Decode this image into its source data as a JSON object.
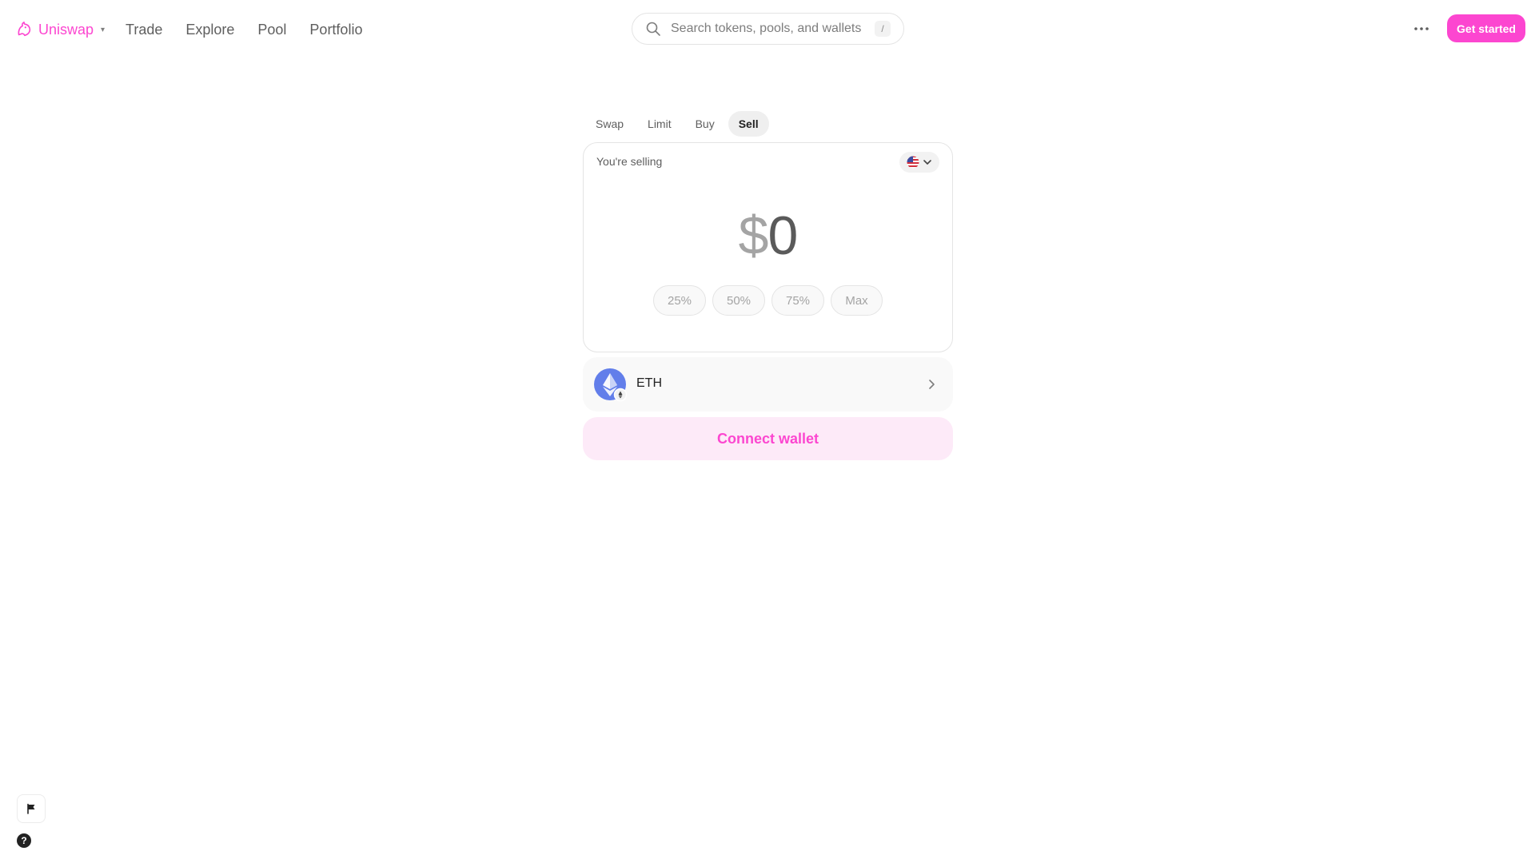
{
  "nav": {
    "logo_text": "Uniswap",
    "logo_caret": "▾",
    "links": [
      "Trade",
      "Explore",
      "Pool",
      "Portfolio"
    ],
    "search_placeholder": "Search tokens, pools, and wallets",
    "search_shortcut": "/",
    "get_started_label": "Get started"
  },
  "tabs": [
    {
      "label": "Swap",
      "active": false
    },
    {
      "label": "Limit",
      "active": false
    },
    {
      "label": "Buy",
      "active": false
    },
    {
      "label": "Sell",
      "active": true
    }
  ],
  "sell_panel": {
    "label": "You're selling",
    "currency_icon": "us-flag-icon",
    "amount_symbol": "$",
    "amount_value": "0",
    "percent_options": [
      "25%",
      "50%",
      "75%",
      "Max"
    ]
  },
  "token": {
    "symbol": "ETH",
    "icon": "ethereum-icon"
  },
  "connect_wallet_label": "Connect wallet",
  "help_label": "?",
  "colors": {
    "accent": "#fc46d0",
    "accent_soft": "#fdeaf8",
    "eth_blue": "#627eea"
  }
}
